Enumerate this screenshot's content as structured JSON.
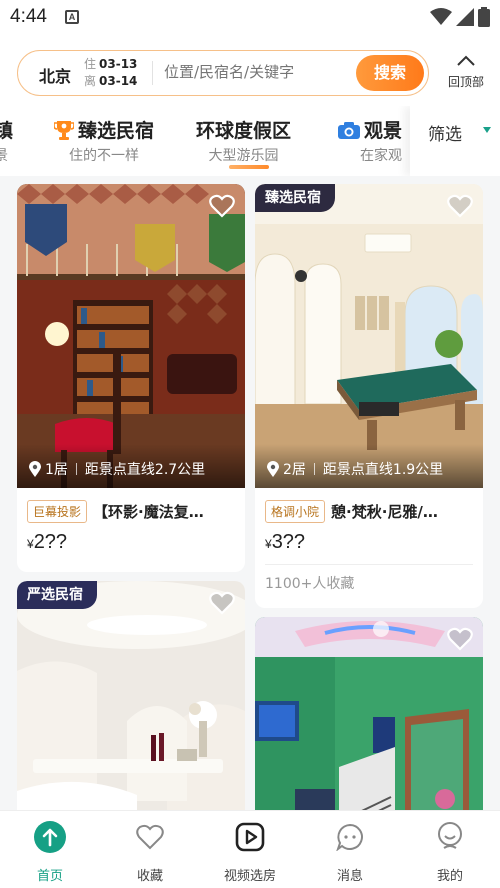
{
  "status_bar": {
    "time": "4:44",
    "app_badge": "A"
  },
  "search": {
    "city": "北京",
    "checkin_label": "住",
    "checkin_date": "03-13",
    "checkout_label": "离",
    "checkout_date": "03-14",
    "placeholder": "位置/民宿名/关键字",
    "button_label": "搜索"
  },
  "back_to_top": {
    "label": "回顶部"
  },
  "tabs": [
    {
      "title": "镇",
      "subtitle": "景",
      "icon": "none"
    },
    {
      "title": "臻选民宿",
      "subtitle": "住的不一样",
      "icon": "trophy-icon"
    },
    {
      "title": "环球度假区",
      "subtitle": "大型游乐园",
      "icon": "none",
      "active": true
    },
    {
      "title": "观景",
      "subtitle": "在家观",
      "icon": "camera-icon"
    }
  ],
  "filter": {
    "label": "筛选"
  },
  "listings": [
    {
      "badge": "",
      "rooms": "1居",
      "distance": "距景点直线2.7公里",
      "tag": "巨幕投影",
      "title": "【环影·魔法复…",
      "currency": "¥",
      "price": "2??",
      "collections": ""
    },
    {
      "badge": "臻选民宿",
      "rooms": "2居",
      "distance": "距景点直线1.9公里",
      "tag": "格调小院",
      "title": "憩·梵秋·尼雅/…",
      "currency": "¥",
      "price": "3??",
      "collections": "1100+人收藏"
    },
    {
      "badge": "严选民宿"
    },
    {
      "badge": ""
    }
  ],
  "bottom_nav": [
    {
      "label": "首页",
      "icon": "home-arrow-icon",
      "active": true
    },
    {
      "label": "收藏",
      "icon": "heart-icon"
    },
    {
      "label": "视频选房",
      "icon": "video-play-icon"
    },
    {
      "label": "消息",
      "icon": "message-icon"
    },
    {
      "label": "我的",
      "icon": "profile-icon"
    }
  ],
  "colors": {
    "accent": "#ff8a2a",
    "nav_active": "#16a085",
    "badge_dark": "#2d2a40"
  }
}
